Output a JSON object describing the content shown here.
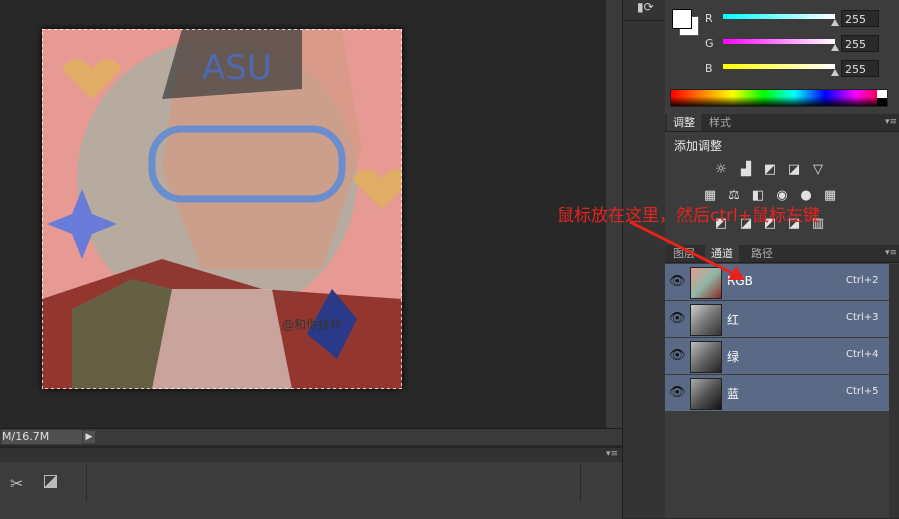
{
  "status_bar": {
    "doc_size": "M/16.7M"
  },
  "color_panel": {
    "channels": [
      {
        "label": "R",
        "value": "255"
      },
      {
        "label": "G",
        "value": "255"
      },
      {
        "label": "B",
        "value": "255"
      }
    ]
  },
  "adjustments_panel": {
    "tabs": [
      "调整",
      "样式"
    ],
    "title": "添加调整"
  },
  "layers_panel": {
    "tabs": [
      "图层",
      "通道",
      "路径"
    ],
    "channels": [
      {
        "name": "RGB",
        "shortcut": "Ctrl+2"
      },
      {
        "name": "红",
        "shortcut": "Ctrl+3"
      },
      {
        "name": "绿",
        "shortcut": "Ctrl+4"
      },
      {
        "name": "蓝",
        "shortcut": "Ctrl+5"
      }
    ]
  },
  "annotation": {
    "text": "鼠标放在这里，然后ctrl+鼠标左键"
  },
  "canvas": {
    "watermark": "@和你妹坏"
  },
  "colors": {
    "selected_row": "#5a6a86",
    "annotation": "#e8231e"
  }
}
